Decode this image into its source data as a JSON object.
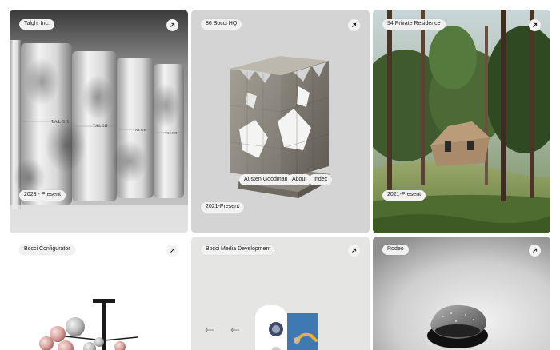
{
  "cards": [
    {
      "title": "Talgh, Inc.",
      "date": "2023 - Present",
      "brand_label": "TALGH"
    },
    {
      "title": "86 Bocci HQ",
      "date": "2021-Present"
    },
    {
      "title": "94 Private Residence",
      "date": "2021-Present"
    },
    {
      "title": "Bocci Configurator"
    },
    {
      "title": "Bocci Media Development"
    },
    {
      "title": "Rodeo"
    }
  ],
  "nav": {
    "name": "Austen Goodman",
    "about": "About",
    "index": "Index"
  },
  "icons": {
    "arrow": "arrow-up-right-icon"
  },
  "colors": {
    "pill_bg": "#f1f1f1",
    "text": "#1a1a1a"
  }
}
